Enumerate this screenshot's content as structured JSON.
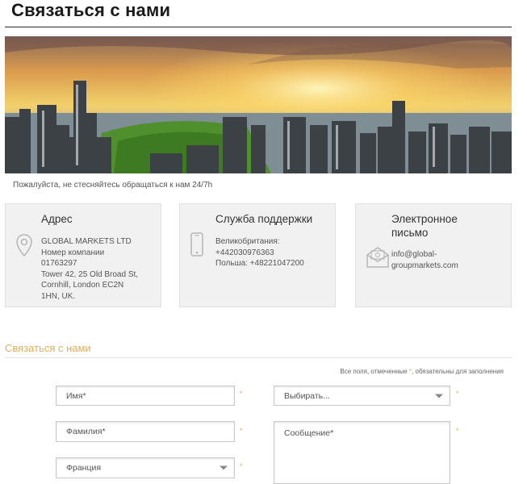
{
  "page": {
    "title": "Связаться с нами",
    "tagline": "Пожалуйста, не стесняйтесь обращаться к нам 24/7h"
  },
  "cards": {
    "address": {
      "title": "Адрес",
      "icon": "location-pin-icon",
      "text": "GLOBAL MARKETS LTD\nНомер компании\n01763297\nTower 42, 25 Old Broad St,\nCornhill, London EC2N\n1HN, UK."
    },
    "support": {
      "title": "Служба поддержки",
      "icon": "phone-icon",
      "text": "Великобритания:\n+442030976363\nПольша: +48221047200"
    },
    "email": {
      "title": "Электронное\nписьмо",
      "icon": "envelope-icon",
      "text": "info@global-\ngroupmarkets.com"
    }
  },
  "form": {
    "section_title": "Связаться с нами",
    "required_note_prefix": "Все поля, отмеченные",
    "required_note_star": "*",
    "required_note_suffix": ", обязательны для заполнения",
    "required_star": "*",
    "first_name_placeholder": "Имя*",
    "last_name_placeholder": "Фамилия*",
    "country_value": "Франция",
    "topic_value": "Выбирать...",
    "message_placeholder": "Сообщение*"
  },
  "colors": {
    "accent": "#e0ae5a",
    "card_bg": "#f1f1f1"
  }
}
